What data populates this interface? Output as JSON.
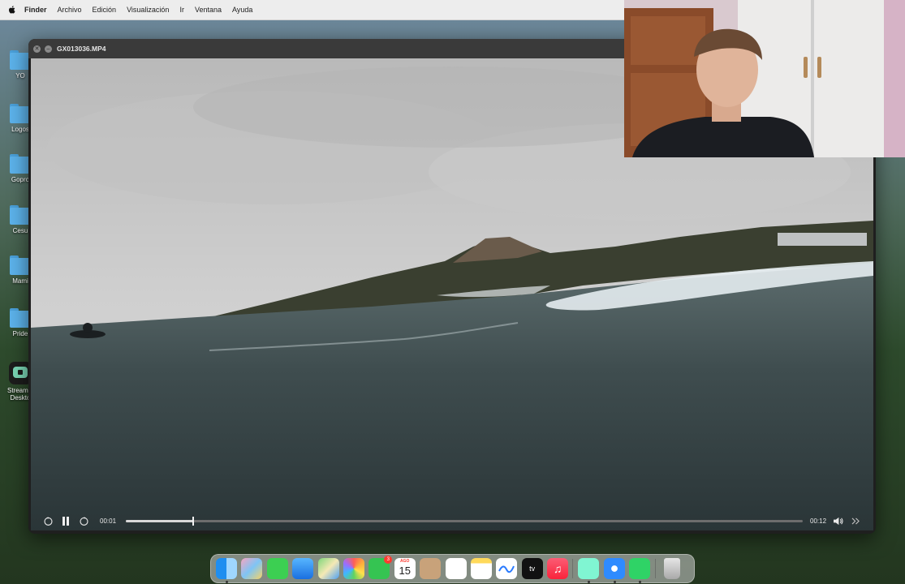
{
  "menubar": {
    "items": [
      "Finder",
      "Archivo",
      "Edición",
      "Visualización",
      "Ir",
      "Ventana",
      "Ayuda"
    ]
  },
  "desktop": {
    "items": [
      {
        "label": "YO"
      },
      {
        "label": "Logos"
      },
      {
        "label": "Gopro"
      },
      {
        "label": "Cesu"
      },
      {
        "label": "Mami"
      },
      {
        "label": "Pride"
      },
      {
        "label": "Streamla Deskto"
      }
    ]
  },
  "player": {
    "title": "GX013036.MP4",
    "current_time": "00:01",
    "total_time": "00:12",
    "progress": 0.1
  },
  "dock": {
    "calendar_month": "AGO",
    "calendar_day": "15",
    "facetime_badge": "3",
    "tv_label": "tv",
    "apps": [
      "finder-icon",
      "launchpad-icon",
      "messages-icon",
      "mail-icon",
      "maps-icon",
      "photos-icon",
      "facetime-icon",
      "calendar-icon",
      "contacts-icon",
      "reminders-icon",
      "notes-icon",
      "freeform-icon",
      "apple-tv-icon",
      "music-icon",
      "streamlabs-icon",
      "safari-icon",
      "whatsapp-icon",
      "trash-icon"
    ]
  },
  "colors": {
    "menubar_bg": "#ededed",
    "window_titlebar": "#3a3a3a",
    "folder_blue": "#5cb2ea"
  }
}
